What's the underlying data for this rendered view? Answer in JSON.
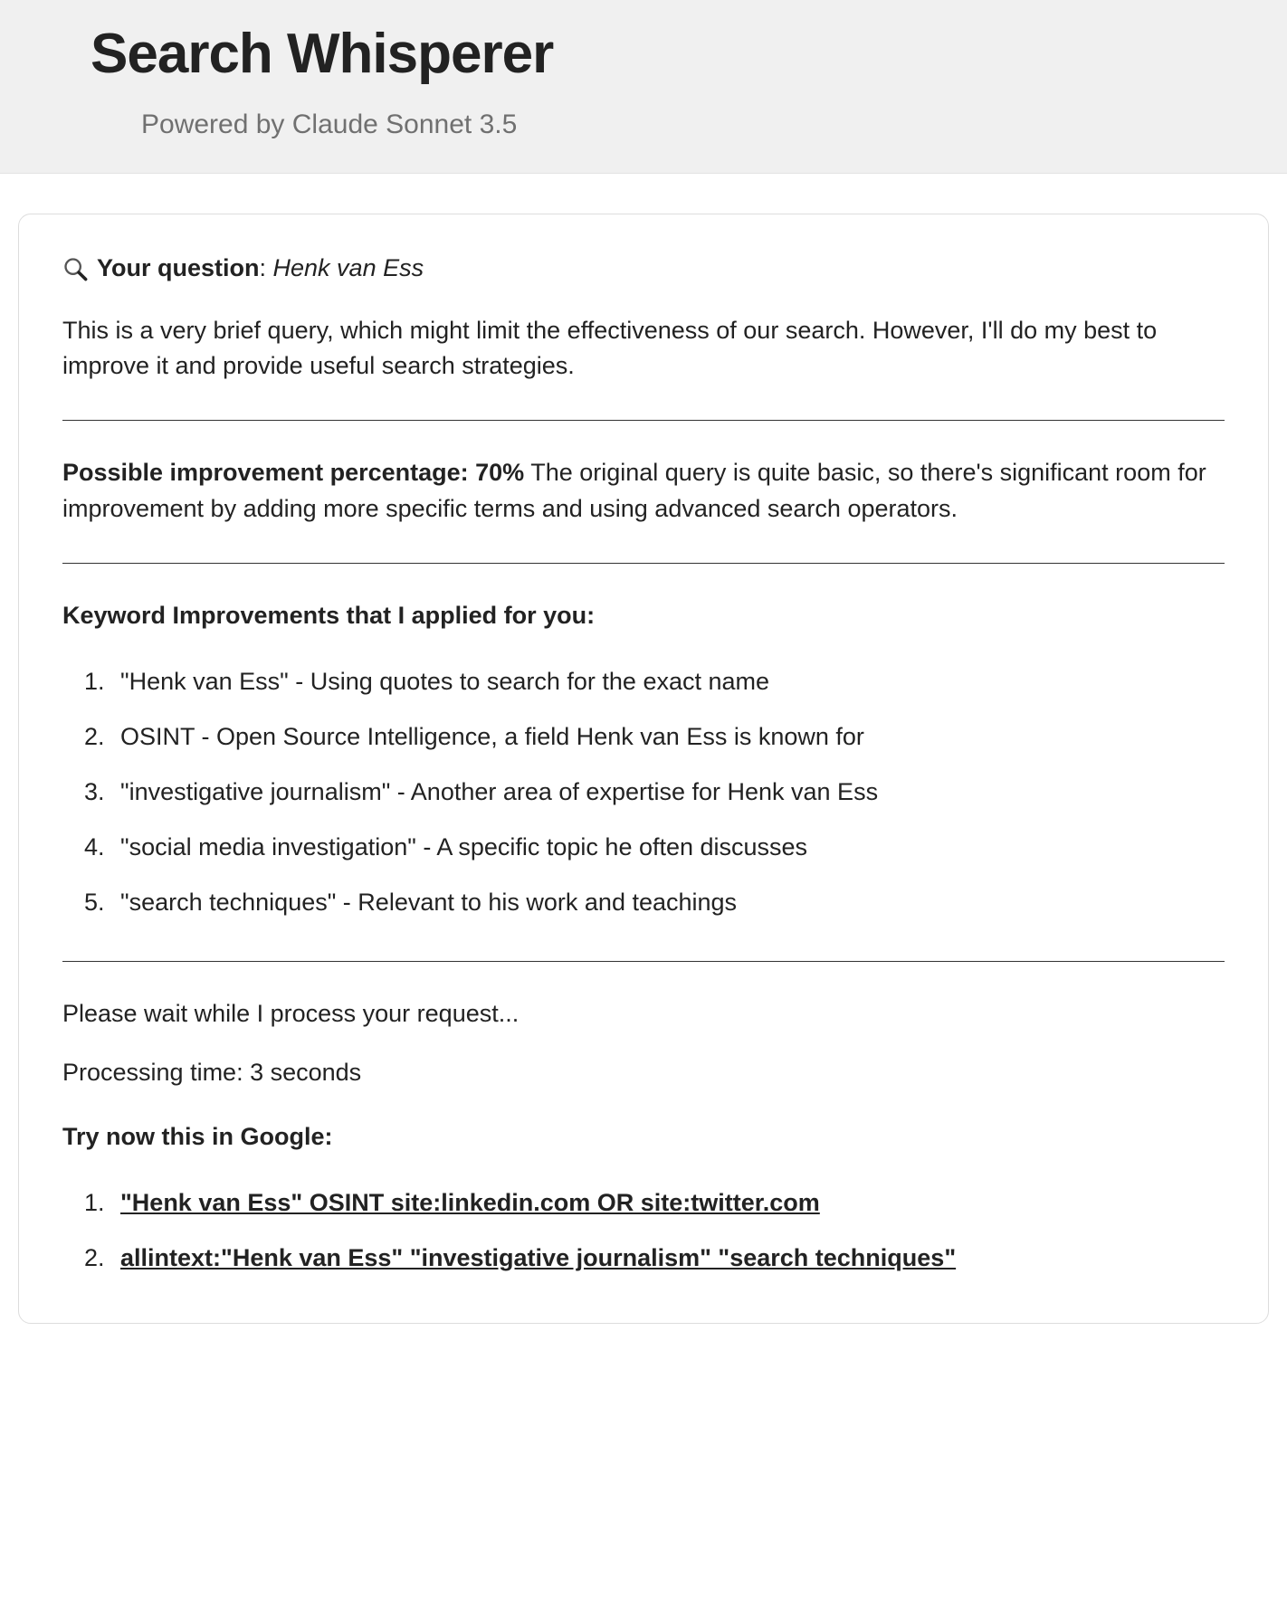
{
  "header": {
    "title": "Search Whisperer",
    "subtitle": "Powered by Claude Sonnet 3.5"
  },
  "question": {
    "label": "Your question",
    "value": "Henk van Ess"
  },
  "intro": "This is a very brief query, which might limit the effectiveness of our search. However, I'll do my best to improve it and provide useful search strategies.",
  "improvement": {
    "label": "Possible improvement percentage: 70%",
    "text": " The original query is quite basic, so there's significant room for improvement by adding more specific terms and using advanced search operators."
  },
  "keywords": {
    "heading": "Keyword Improvements that I applied for you:",
    "items": [
      "\"Henk van Ess\" - Using quotes to search for the exact name",
      "OSINT - Open Source Intelligence, a field Henk van Ess is known for",
      "\"investigative journalism\" - Another area of expertise for Henk van Ess",
      "\"social media investigation\" - A specific topic he often discusses",
      "\"search techniques\" - Relevant to his work and teachings"
    ]
  },
  "wait_text": "Please wait while I process your request...",
  "processing_text": "Processing time: 3 seconds",
  "try": {
    "heading": "Try now this in Google:",
    "items": [
      "\"Henk van Ess\" OSINT site:linkedin.com OR site:twitter.com",
      "allintext:\"Henk van Ess\" \"investigative journalism\" \"search techniques\""
    ]
  }
}
